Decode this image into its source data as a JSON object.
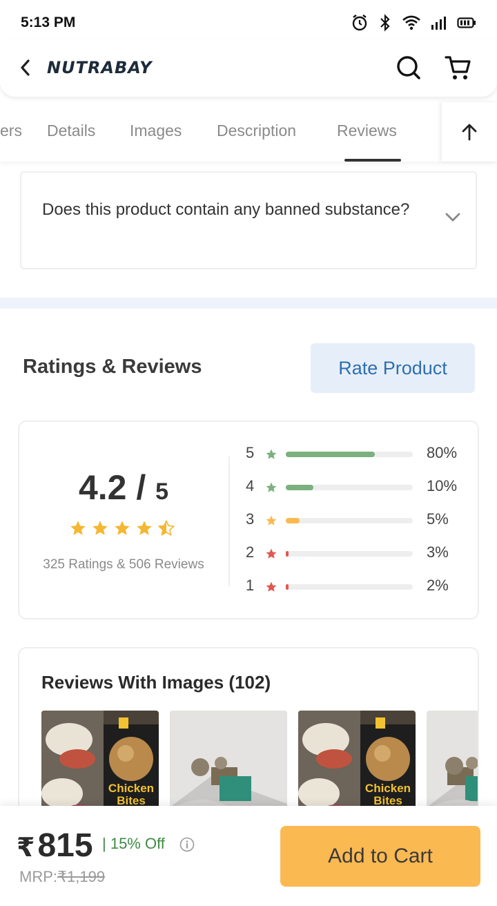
{
  "status_bar": {
    "time": "5:13 PM"
  },
  "header": {
    "logo": "NUTRABAY"
  },
  "tabs": [
    {
      "label": "ers",
      "active": false
    },
    {
      "label": "Details",
      "active": false
    },
    {
      "label": "Images",
      "active": false
    },
    {
      "label": "Description",
      "active": false
    },
    {
      "label": "Reviews",
      "active": true
    }
  ],
  "faq": {
    "question": "Does this product contain any banned substance?"
  },
  "ratings": {
    "title": "Ratings & Reviews",
    "rate_button": "Rate Product",
    "average": "4.2",
    "separator": " / ",
    "out_of": "5",
    "stars_value": 4.5,
    "count_text": "325 Ratings & 506 Reviews",
    "distribution": [
      {
        "star": "5",
        "percent_label": "80%",
        "fill_percent": 70,
        "color": "#7cb07f"
      },
      {
        "star": "4",
        "percent_label": "10%",
        "fill_percent": 22,
        "color": "#7cb07f"
      },
      {
        "star": "3",
        "percent_label": "5%",
        "fill_percent": 11,
        "color": "#fbb951"
      },
      {
        "star": "2",
        "percent_label": "3%",
        "fill_percent": 2,
        "color": "#e0584e"
      },
      {
        "star": "1",
        "percent_label": "2%",
        "fill_percent": 2,
        "color": "#e0584e"
      }
    ]
  },
  "reviews_with_images": {
    "title": "Reviews With Images (102)"
  },
  "bottom_bar": {
    "currency_symbol": "₹",
    "price": "815",
    "discount": "| 15% Off",
    "mrp_label": "MRP:",
    "mrp_value": "₹1,199",
    "add_to_cart": "Add to Cart"
  },
  "colors": {
    "accent_blue": "#2f6fb0",
    "cta_orange": "#fbb951",
    "star_gold": "#f5b731",
    "discount_green": "#3e8a44"
  }
}
